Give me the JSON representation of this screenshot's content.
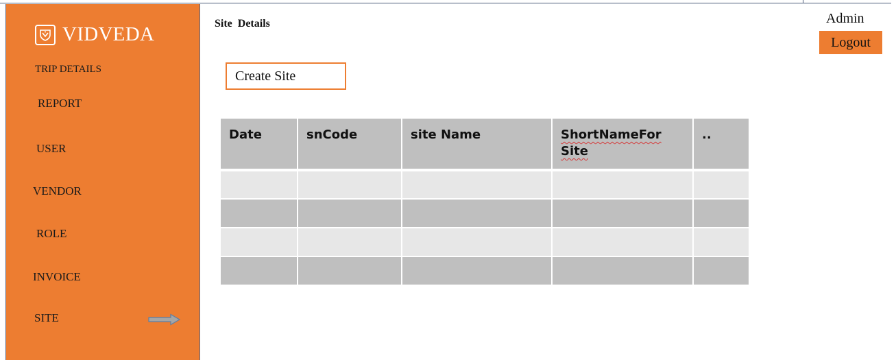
{
  "app": {
    "brand": "VIDVEDA",
    "logo_icon": "shield-crest-icon"
  },
  "user": {
    "name": "Admin",
    "logout_label": "Logout"
  },
  "sidebar": {
    "items": [
      {
        "label": "TRIP DETAILS"
      },
      {
        "label": "REPORT"
      },
      {
        "label": "USER"
      },
      {
        "label": "VENDOR"
      },
      {
        "label": "ROLE"
      },
      {
        "label": "INVOICE"
      },
      {
        "label": "SITE",
        "active": true
      }
    ],
    "active_indicator_icon": "right-arrow-icon"
  },
  "main": {
    "title": "Site  Details",
    "create_button_label": "Create Site",
    "table": {
      "columns": [
        "Date",
        "snCode",
        "site Name",
        "ShortNameFor Site",
        ".."
      ],
      "rows": [
        [
          "",
          "",
          "",
          "",
          ""
        ],
        [
          "",
          "",
          "",
          "",
          ""
        ],
        [
          "",
          "",
          "",
          "",
          ""
        ],
        [
          "",
          "",
          "",
          "",
          ""
        ]
      ]
    }
  },
  "colors": {
    "accent": "#ed7d31",
    "table_header": "#bfbfbf",
    "row_light": "#e7e7e7",
    "row_dark": "#bfbfbf"
  }
}
